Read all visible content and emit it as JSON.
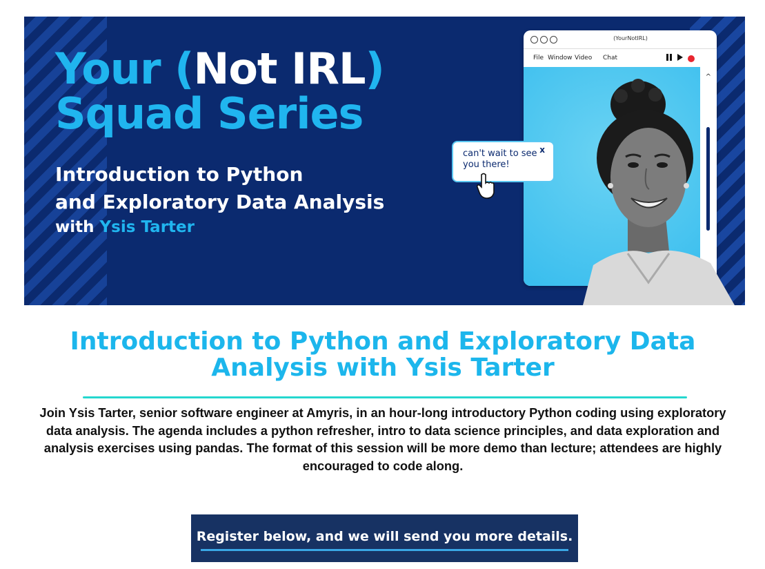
{
  "banner": {
    "title_part1": "Your",
    "title_paren_open": "(",
    "title_not_irl": "Not IRL",
    "title_paren_close": ")",
    "title_line2": "Squad Series",
    "subtitle_line1": "Introduction to Python",
    "subtitle_line2": "and Exploratory Data Analysis",
    "with_label": "with",
    "speaker": "Ysis Tarter",
    "window": {
      "title": "(YourNotIRL)",
      "menu": [
        "File",
        "Window",
        "Video",
        "Chat"
      ],
      "pause_icon": "pause-icon",
      "play_icon": "play-icon",
      "record_icon": "record-icon",
      "scroll_caret": "^"
    },
    "chat_bubble": {
      "text": "can't wait to see you there!",
      "close": "x"
    },
    "colors": {
      "navy": "#0b2a6f",
      "cyan": "#20b5ef",
      "screen_blue": "#38bdee"
    }
  },
  "heading": "Introduction to Python and Exploratory Data Analysis with Ysis Tarter",
  "description": "Join Ysis Tarter, senior software engineer at Amyris, in an hour-long introductory Python coding using exploratory data analysis. The agenda includes a python refresher, intro to data science principles, and data exploration and analysis exercises using pandas. The format of this session will be more demo than lecture; attendees are highly encouraged to code along.",
  "cta": {
    "label": "Register below, and we will send you more details."
  }
}
